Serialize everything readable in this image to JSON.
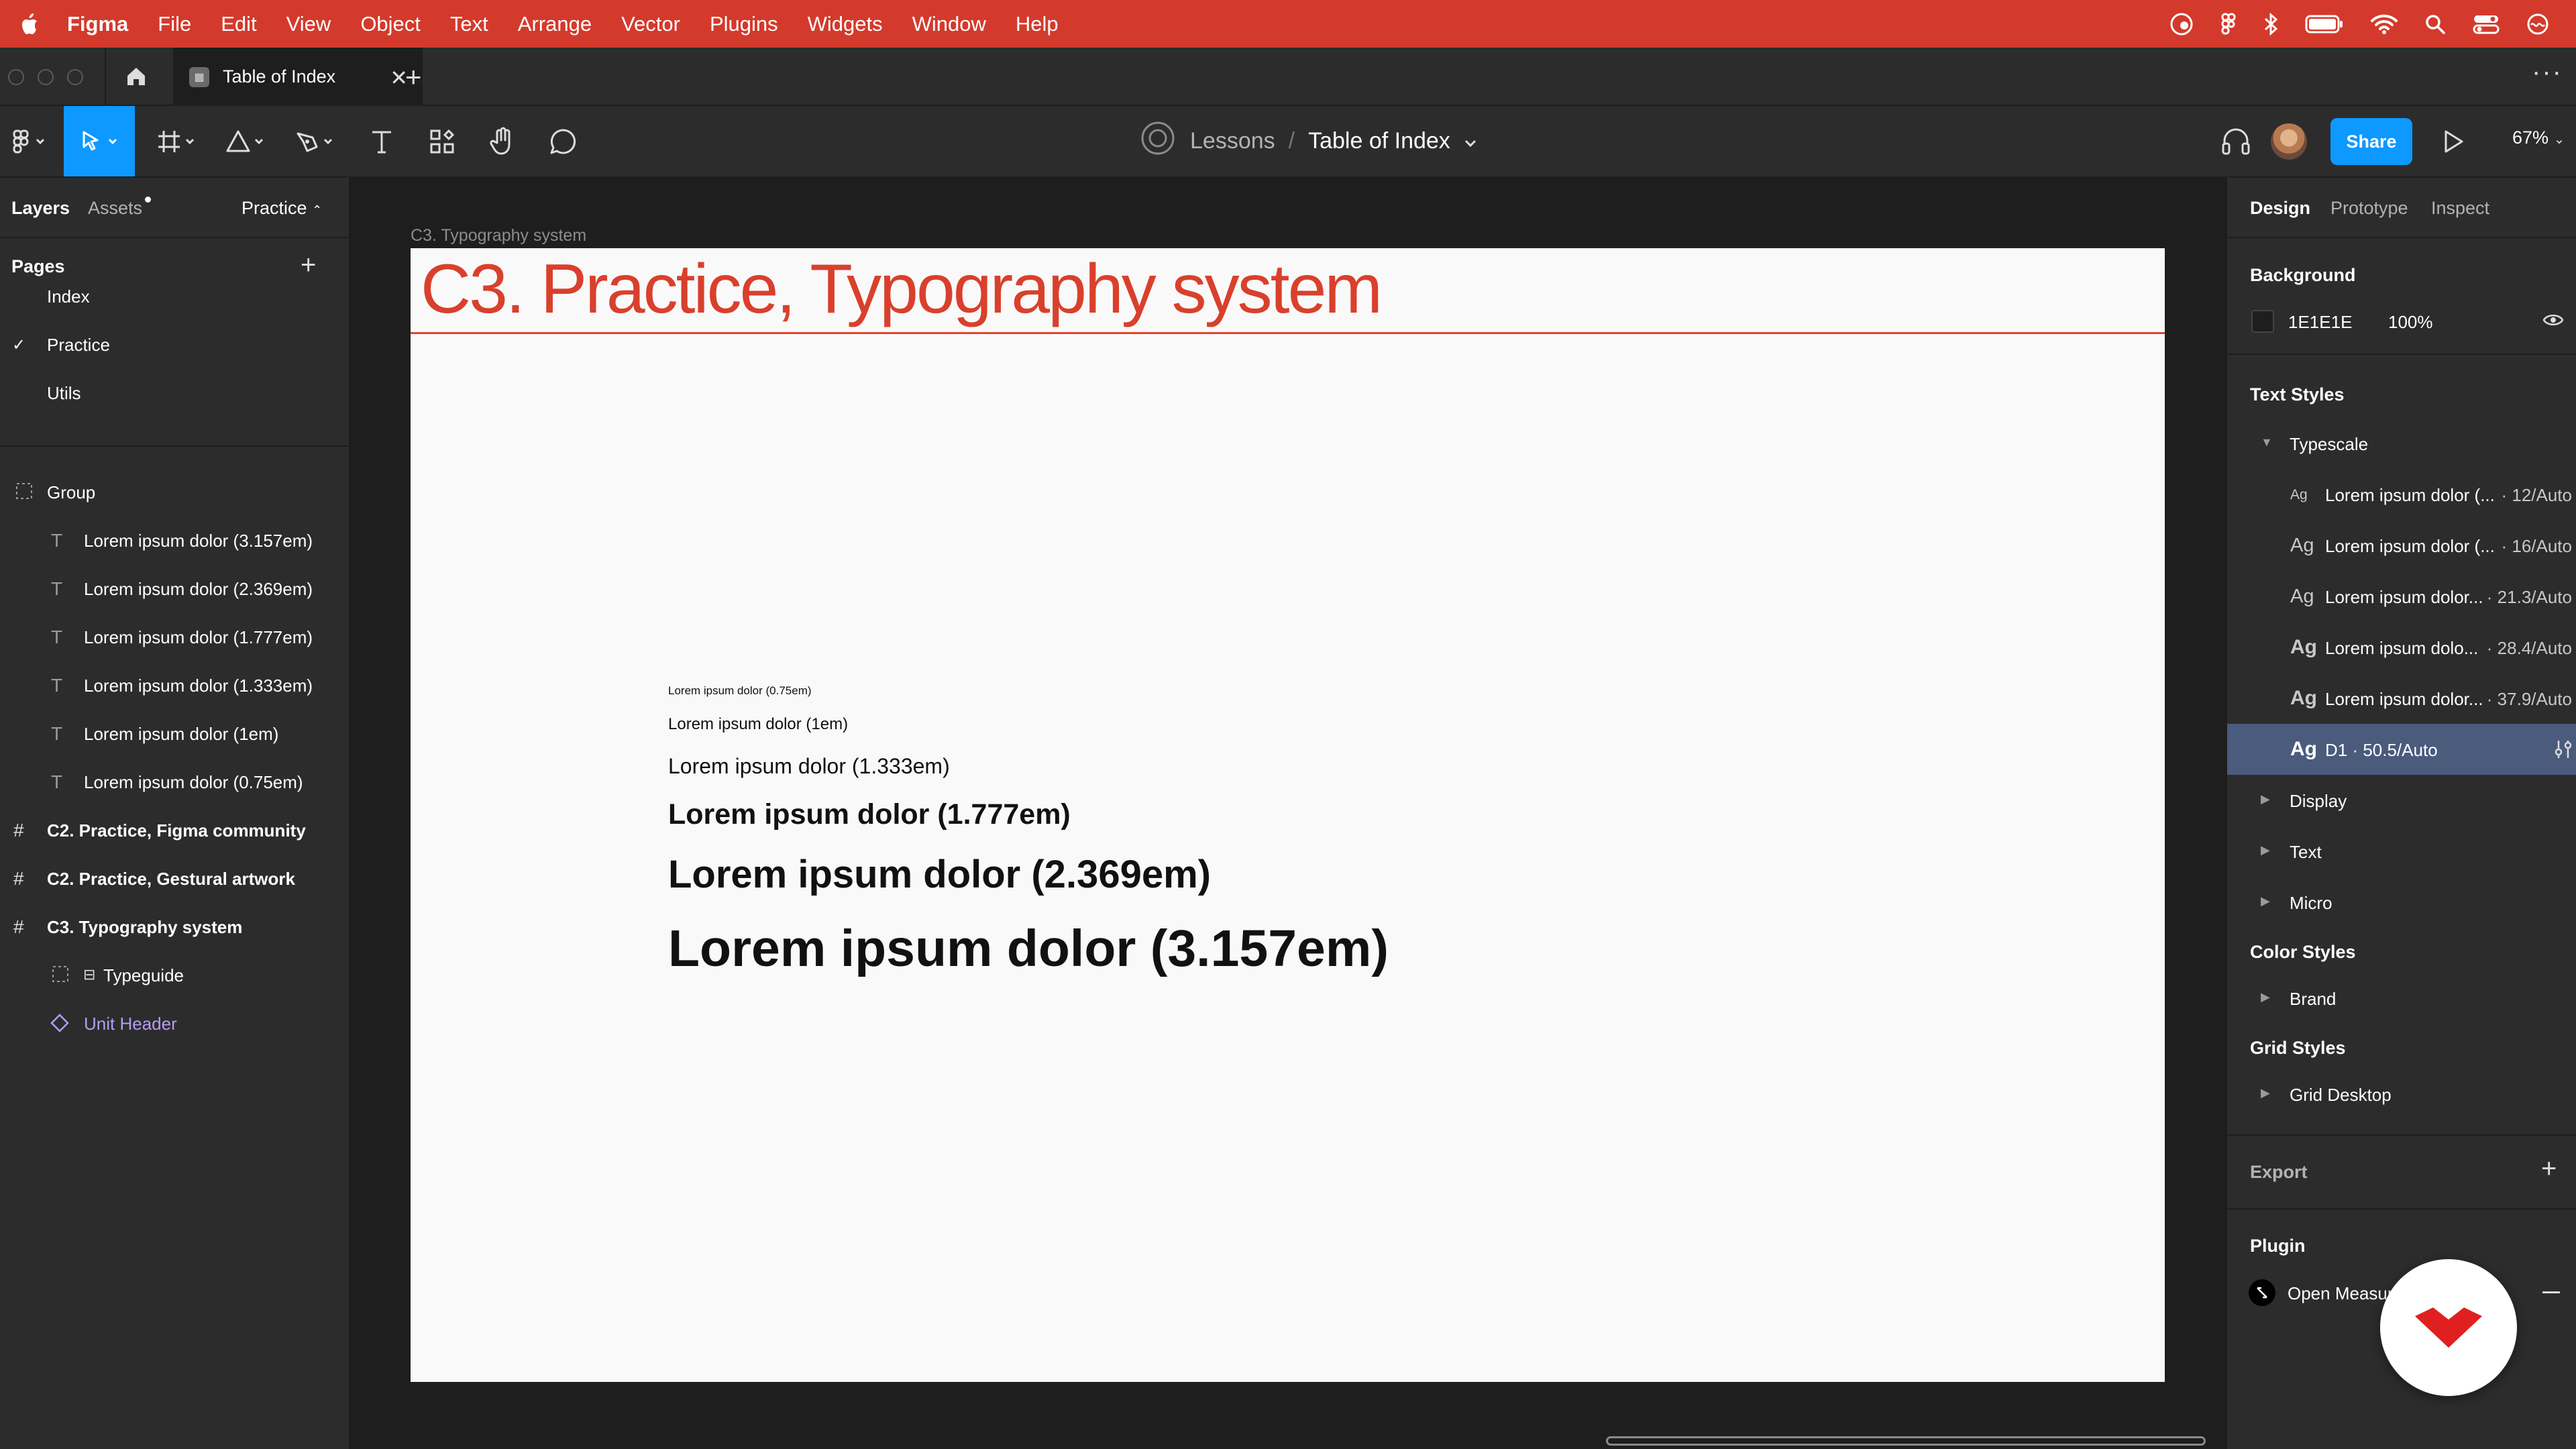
{
  "menubar": {
    "app": "Figma",
    "items": [
      "File",
      "Edit",
      "View",
      "Object",
      "Text",
      "Arrange",
      "Vector",
      "Plugins",
      "Widgets",
      "Window",
      "Help"
    ],
    "bg_color": "#d33a2c"
  },
  "tabbar": {
    "tab_title": "Table of Index"
  },
  "toolbar": {
    "team": "Lessons",
    "separator": "/",
    "file": "Table of Index",
    "share_label": "Share",
    "zoom": "67%",
    "accent": "#0d99ff"
  },
  "left_panel": {
    "tabs": {
      "layers": "Layers",
      "assets": "Assets",
      "page": "Practice"
    },
    "pages_title": "Pages",
    "pages": [
      {
        "label": "Index",
        "selected": false
      },
      {
        "label": "Practice",
        "selected": true
      },
      {
        "label": "Utils",
        "selected": false
      }
    ],
    "layers": {
      "group": "Group",
      "text_layers": [
        "Lorem ipsum dolor (3.157em)",
        "Lorem ipsum dolor (2.369em)",
        "Lorem ipsum dolor (1.777em)",
        "Lorem ipsum dolor (1.333em)",
        "Lorem ipsum dolor (1em)",
        "Lorem ipsum dolor (0.75em)"
      ],
      "frames": [
        "C2. Practice, Figma community",
        "C2. Practice, Gestural artwork",
        "C3. Typography system"
      ],
      "children": {
        "typeguide": "Typeguide",
        "unit_header": "Unit Header"
      }
    }
  },
  "canvas": {
    "frame_label": "C3. Typography system",
    "frame_title": "C3.  Practice, Typography system",
    "title_color": "#d9402c",
    "frame_bg": "#f9f9f9",
    "samples": [
      "Lorem ipsum dolor (0.75em)",
      "Lorem ipsum dolor (1em)",
      "Lorem ipsum dolor (1.333em)",
      "Lorem ipsum dolor (1.777em)",
      "Lorem ipsum dolor (2.369em)",
      "Lorem ipsum dolor (3.157em)"
    ]
  },
  "right_panel": {
    "tabs": {
      "design": "Design",
      "prototype": "Prototype",
      "inspect": "Inspect"
    },
    "background_title": "Background",
    "background_hex": "1E1E1E",
    "background_opacity": "100%",
    "text_styles_title": "Text Styles",
    "typescale_group": "Typescale",
    "typescale_items": [
      {
        "ag": "Ag",
        "name": "Lorem ipsum dolor (...",
        "size": "· 12/Auto"
      },
      {
        "ag": "Ag",
        "name": "Lorem ipsum dolor (...",
        "size": "· 16/Auto"
      },
      {
        "ag": "Ag",
        "name": "Lorem ipsum dolor...",
        "size": "· 21.3/Auto"
      },
      {
        "ag": "Ag",
        "name": "Lorem ipsum dolo...",
        "size": "· 28.4/Auto"
      },
      {
        "ag": "Ag",
        "name": "Lorem ipsum dolor...",
        "size": "· 37.9/Auto"
      },
      {
        "ag": "Ag",
        "name": "D1 · 50.5/Auto",
        "size": ""
      }
    ],
    "text_groups": [
      "Display",
      "Text",
      "Micro"
    ],
    "color_styles_title": "Color Styles",
    "color_groups": [
      "Brand"
    ],
    "grid_styles_title": "Grid Styles",
    "grid_groups": [
      "Grid Desktop"
    ],
    "export_title": "Export",
    "plugin_title": "Plugin",
    "plugin_name": "Open Measur"
  }
}
